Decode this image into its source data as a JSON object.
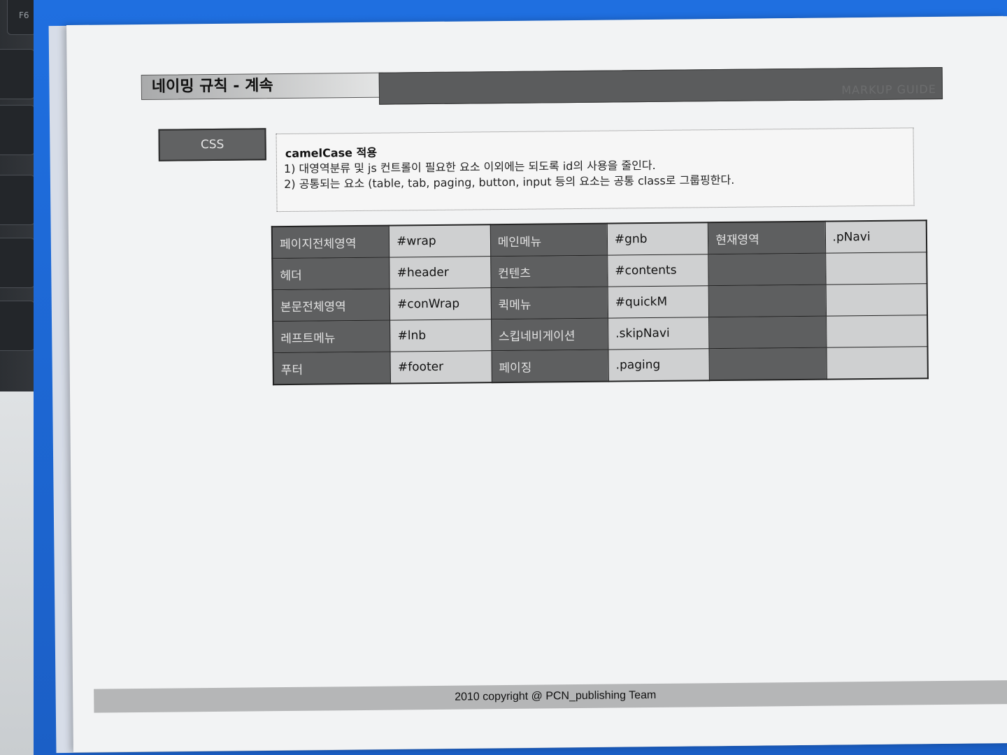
{
  "header": {
    "title": "네이밍 규칙 - 계속",
    "guide": "MARKUP GUIDE"
  },
  "badge": "CSS",
  "note": {
    "title": "camelCase 적용",
    "lines": [
      "1) 대영역분류 및 js 컨트롤이 필요한 요소 이외에는 되도록 id의 사용을 줄인다.",
      "2) 공통되는 요소 (table, tab, paging, button, input 등의 요소는 공통 class로 그룹핑한다."
    ]
  },
  "table": {
    "rows": [
      [
        "페이지전체영역",
        "#wrap",
        "메인메뉴",
        "#gnb",
        "현재영역",
        ".pNavi"
      ],
      [
        "헤더",
        "#header",
        "컨텐츠",
        "#contents",
        "",
        ""
      ],
      [
        "본문전체영역",
        "#conWrap",
        "퀵메뉴",
        "#quickM",
        "",
        ""
      ],
      [
        "레프트메뉴",
        "#lnb",
        "스킵네비게이션",
        ".skipNavi",
        "",
        ""
      ],
      [
        "푸터",
        "#footer",
        "페이징",
        ".paging",
        "",
        ""
      ]
    ]
  },
  "footer": "2010 copyright @ PCN_publishing Team",
  "keyboard": {
    "f6": "F6"
  }
}
